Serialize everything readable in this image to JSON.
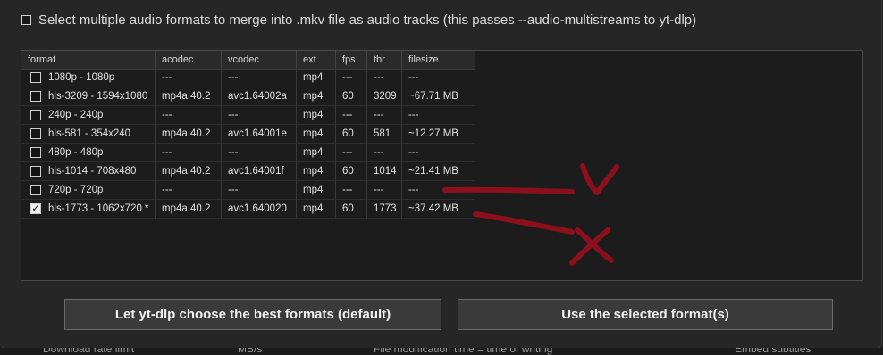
{
  "multistream": {
    "label": "Select multiple audio formats to merge into .mkv file as audio tracks (this passes --audio-multistreams to yt-dlp)",
    "checked": false
  },
  "table": {
    "columns": [
      "format",
      "acodec",
      "vcodec",
      "ext",
      "fps",
      "tbr",
      "filesize"
    ],
    "rows": [
      {
        "checked": false,
        "format": "1080p - 1080p",
        "acodec": "---",
        "vcodec": "---",
        "ext": "mp4",
        "fps": "---",
        "tbr": "---",
        "filesize": "---"
      },
      {
        "checked": false,
        "format": "hls-3209 - 1594x1080",
        "acodec": "mp4a.40.2",
        "vcodec": "avc1.64002a",
        "ext": "mp4",
        "fps": "60",
        "tbr": "3209",
        "filesize": "~67.71 MB"
      },
      {
        "checked": false,
        "format": "240p - 240p",
        "acodec": "---",
        "vcodec": "---",
        "ext": "mp4",
        "fps": "---",
        "tbr": "---",
        "filesize": "---"
      },
      {
        "checked": false,
        "format": "hls-581 - 354x240",
        "acodec": "mp4a.40.2",
        "vcodec": "avc1.64001e",
        "ext": "mp4",
        "fps": "60",
        "tbr": "581",
        "filesize": "~12.27 MB"
      },
      {
        "checked": false,
        "format": "480p - 480p",
        "acodec": "---",
        "vcodec": "---",
        "ext": "mp4",
        "fps": "---",
        "tbr": "---",
        "filesize": "---"
      },
      {
        "checked": false,
        "format": "hls-1014 - 708x480",
        "acodec": "mp4a.40.2",
        "vcodec": "avc1.64001f",
        "ext": "mp4",
        "fps": "60",
        "tbr": "1014",
        "filesize": "~21.41 MB"
      },
      {
        "checked": false,
        "format": "720p - 720p",
        "acodec": "---",
        "vcodec": "---",
        "ext": "mp4",
        "fps": "---",
        "tbr": "---",
        "filesize": "---"
      },
      {
        "checked": true,
        "format": "hls-1773 - 1062x720 *",
        "acodec": "mp4a.40.2",
        "vcodec": "avc1.640020",
        "ext": "mp4",
        "fps": "60",
        "tbr": "1773",
        "filesize": "~37.42 MB"
      }
    ]
  },
  "buttons": {
    "best_label": "Let yt-dlp choose the best formats (default)",
    "selected_label": "Use the selected format(s)"
  },
  "bottom_strip": {
    "items": [
      "Download rate limit",
      "MB/s",
      "File modification time = time of writing",
      "Embed subtitles"
    ]
  },
  "colors": {
    "annotation": "#8b0f1c",
    "background": "#262626",
    "table_background": "#1c1c1c"
  },
  "icons": {
    "checkbox": "checkbox-icon",
    "checkmark": "checkmark-icon"
  }
}
